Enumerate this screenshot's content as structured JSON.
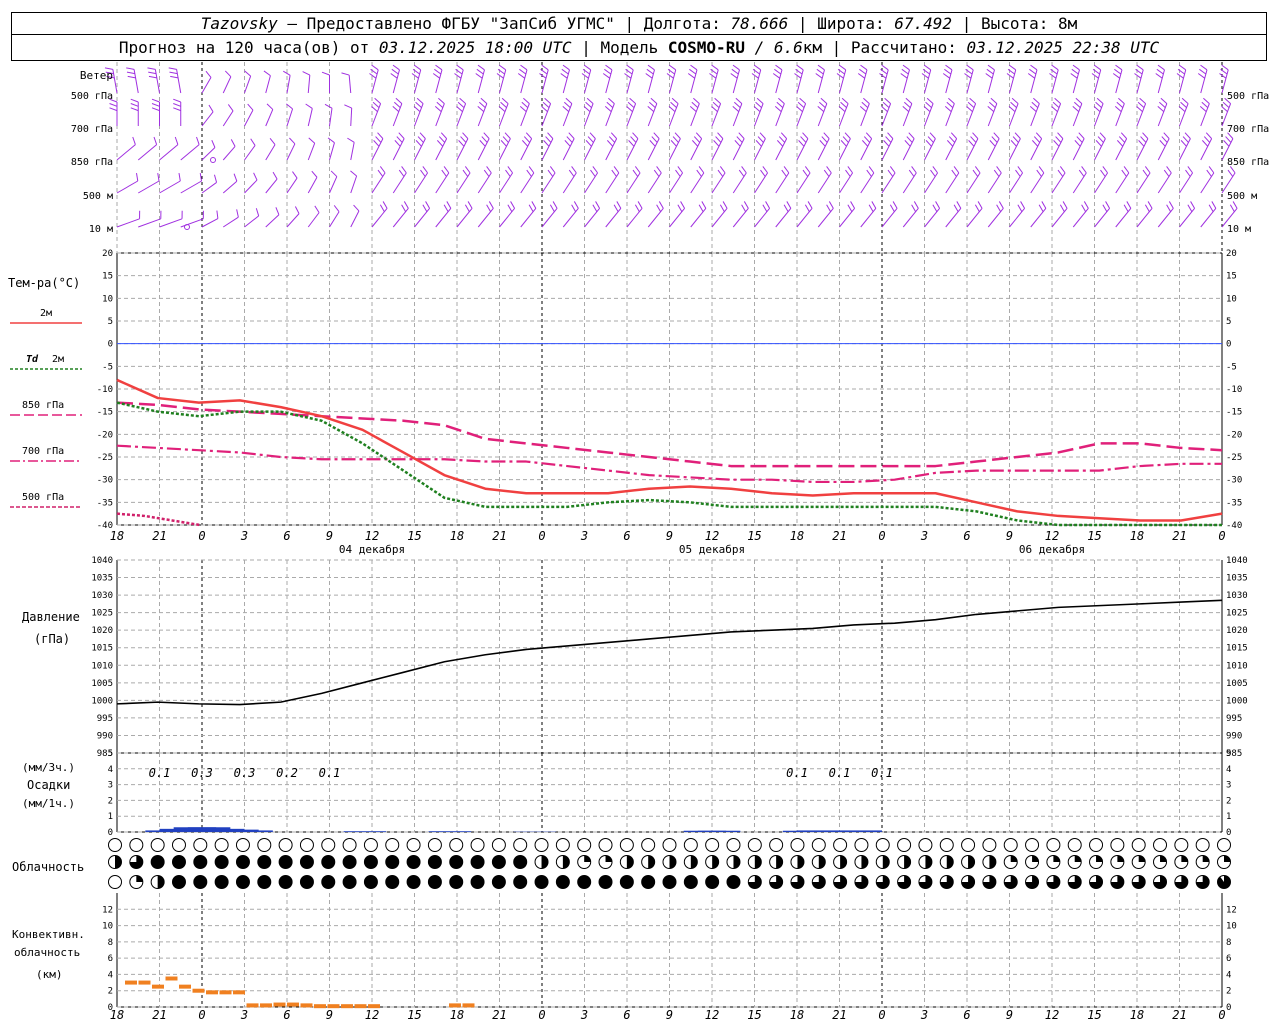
{
  "header": {
    "station": "Tazovsky",
    "provider": " — Предоставлено ФГБУ \"ЗапСиб УГМС\" | Долгота: ",
    "lon": "78.666",
    "lat_label": " | Широта: ",
    "lat": "67.492",
    "alt_label": " | Высота: ",
    "alt": "8м",
    "forecast_label": "Прогноз на 120 часа(ов) от ",
    "run": "03.12.2025 18:00 UTC",
    "model_label": "  | Модель ",
    "model": "COSMO-RU",
    "res": " / 6.6",
    "res_unit": "км",
    "calc_label": " | Рассчитано: ",
    "calc": "03.12.2025 22:38 UTC"
  },
  "colors": {
    "wind": "#a030e0",
    "t2m": "#f04040",
    "td2m": "#208020",
    "t850": "#e0207a",
    "t700": "#e0207a",
    "t500": "#d0206a",
    "zero": "#3050ff",
    "pressure": "#000000",
    "precip": "#2040c0",
    "convective": "#f08020",
    "grid": "#aaaaaa"
  },
  "labels": {
    "wind_title": "Ветер",
    "wind_levels": [
      "500 гПа",
      "700 гПа",
      "850 гПа",
      "500 м",
      "10  м"
    ],
    "temp_title": "Тем-ра(°C)",
    "legend_2m": "2м",
    "legend_td": "Td",
    "legend_td_sub": "2м",
    "legend_850": "850 гПа",
    "legend_700": "700 гПа",
    "legend_500": "500 гПа",
    "pressure_title": "Давление",
    "pressure_unit": "(гПа)",
    "precip_unit3": "(мм/3ч.)",
    "precip_title": "Осадки",
    "precip_unit1": "(мм/1ч.)",
    "cloud_title": "Облачность",
    "conv_title1": "Конвективн.",
    "conv_title2": "облачность",
    "conv_unit": "(км)"
  },
  "chart_data": {
    "type": "line",
    "x_hours": [
      "18",
      "21",
      "0",
      "3",
      "6",
      "9",
      "12",
      "15",
      "18",
      "21",
      "0",
      "3",
      "6",
      "9",
      "12",
      "15",
      "18",
      "21",
      "0",
      "3",
      "6",
      "9",
      "12",
      "15",
      "18",
      "21",
      "0"
    ],
    "dates": [
      "04 декабря",
      "05 декабря",
      "06 декабря"
    ],
    "temperature": {
      "ylim": [
        -40,
        20
      ],
      "ticks": [
        20,
        15,
        10,
        5,
        0,
        -5,
        -10,
        -15,
        -20,
        -25,
        -30,
        -35,
        -40
      ],
      "t2m": [
        -8,
        -12,
        -13,
        -12.5,
        -14,
        -16,
        -19,
        -24,
        -29,
        -32,
        -33,
        -33,
        -33,
        -32,
        -31.5,
        -32,
        -33,
        -33.5,
        -33,
        -33,
        -33,
        -35,
        -37,
        -38,
        -38.5,
        -39,
        -39,
        -37.5
      ],
      "td2m": [
        -13,
        -15,
        -16,
        -15,
        -15,
        -17,
        -22,
        -28,
        -34,
        -36,
        -36,
        -36,
        -35,
        -34.5,
        -35,
        -36,
        -36,
        -36,
        -36,
        -36,
        -36,
        -37,
        -39,
        -40.5,
        -41.5,
        -42,
        -42,
        -42
      ],
      "t850": [
        -13,
        -13.5,
        -14.5,
        -15,
        -15.5,
        -16,
        -16.5,
        -17,
        -18,
        -21,
        -22,
        -23,
        -24,
        -25,
        -26,
        -27,
        -27,
        -27,
        -27,
        -27,
        -27,
        -26,
        -25,
        -24,
        -22,
        -22,
        -23,
        -23.5
      ],
      "t700": [
        -22.5,
        -23,
        -23.5,
        -24,
        -25,
        -25.5,
        -25.5,
        -25.5,
        -25.5,
        -26,
        -26,
        -27,
        -28,
        -29,
        -29.5,
        -30,
        -30,
        -30.5,
        -30.5,
        -30,
        -28.5,
        -28,
        -28,
        -28,
        -28,
        -27,
        -26.5,
        -26.5
      ],
      "t500": [
        -37.5,
        -38,
        -39,
        -40
      ]
    },
    "pressure": {
      "ylim": [
        985,
        1040
      ],
      "ticks": [
        1040,
        1035,
        1030,
        1025,
        1020,
        1015,
        1010,
        1005,
        1000,
        995,
        990,
        985
      ],
      "values": [
        999,
        999.5,
        999,
        998.8,
        999.5,
        1002,
        1005,
        1008,
        1011,
        1013,
        1014.5,
        1015.5,
        1016.5,
        1017.5,
        1018.5,
        1019.5,
        1020,
        1020.5,
        1021.5,
        1022,
        1023,
        1024.5,
        1025.5,
        1026.5,
        1027,
        1027.5,
        1028,
        1028.5
      ]
    },
    "precipitation": {
      "ylim": [
        0,
        5
      ],
      "ticks": [
        5,
        4,
        3,
        2,
        1,
        0
      ],
      "labels_3h": [
        "0.1",
        "0.3",
        "0.3",
        "0.2",
        "0.1",
        "0.1",
        "0.1",
        "0.1"
      ],
      "labels_3h_hours": [
        3,
        6,
        9,
        12,
        15,
        48,
        51,
        54
      ]
    },
    "convective_cloud": {
      "ylim": [
        0,
        14
      ],
      "ticks": [
        12,
        10,
        8,
        6,
        4,
        2,
        0
      ],
      "values_km": [
        3.0,
        3.0,
        2.5,
        3.5,
        2.5,
        2.0,
        1.8,
        1.8,
        1.8,
        0.2,
        0.2,
        0.3,
        0.3,
        0.2,
        0.1,
        0.1,
        0.1,
        0.1,
        0.1,
        0.0,
        0.0,
        0.0,
        0.0,
        0.0,
        0.2,
        0.2,
        0.0
      ]
    },
    "cloud_cover": {
      "rows": [
        "high",
        "mid",
        "low"
      ],
      "note": "fraction 0..1 for each 3h step"
    }
  }
}
